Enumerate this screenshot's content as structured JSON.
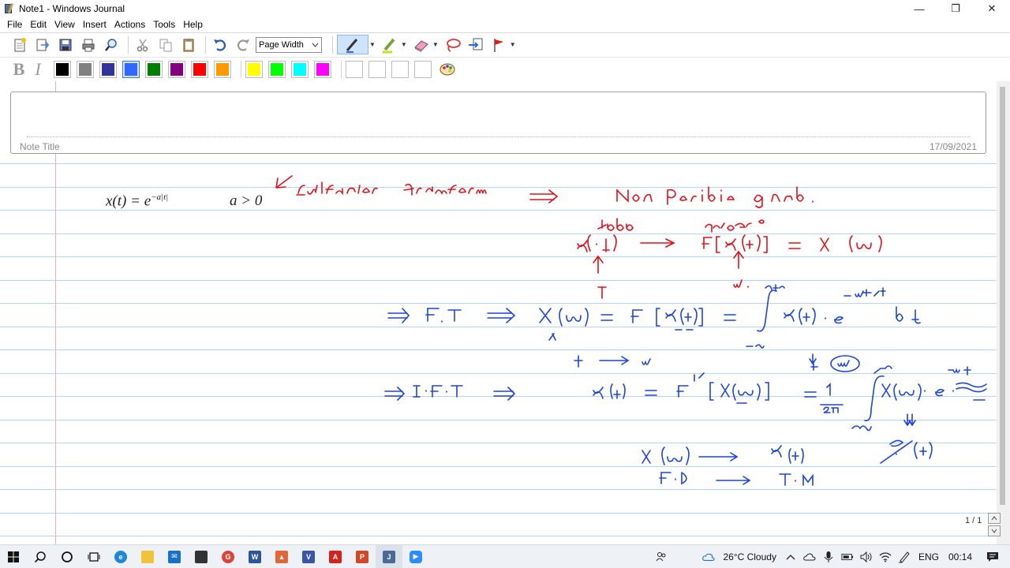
{
  "window": {
    "title": "Note1 - Windows Journal",
    "minimize": "—",
    "maximize": "❐",
    "close": "✕"
  },
  "menu": [
    "File",
    "Edit",
    "View",
    "Insert",
    "Actions",
    "Tools",
    "Help"
  ],
  "toolbar": {
    "zoom_value": "Page Width",
    "format_bold": "B",
    "format_italic": "I",
    "colors": [
      "#000000",
      "#808080",
      "#333399",
      "#3366ff",
      "#008000",
      "#800080",
      "#ff0000",
      "#ff9900",
      "#ffff00",
      "#00ff00",
      "#00ffff",
      "#ff00ff"
    ],
    "selected_color": "#3366ff"
  },
  "note": {
    "title_label": "Note Title",
    "date": "17/09/2021",
    "page_indicator": "1 / 1"
  },
  "typed": {
    "formula_lhs": "x(t) = e",
    "formula_exp": "−a|t|",
    "condition": "a > 0"
  },
  "ink_colors": {
    "red": "#e0101a",
    "blue": "#1e44d8"
  },
  "taskbar": {
    "weather": "26°C  Cloudy",
    "language": "ENG",
    "time": "00:14"
  }
}
